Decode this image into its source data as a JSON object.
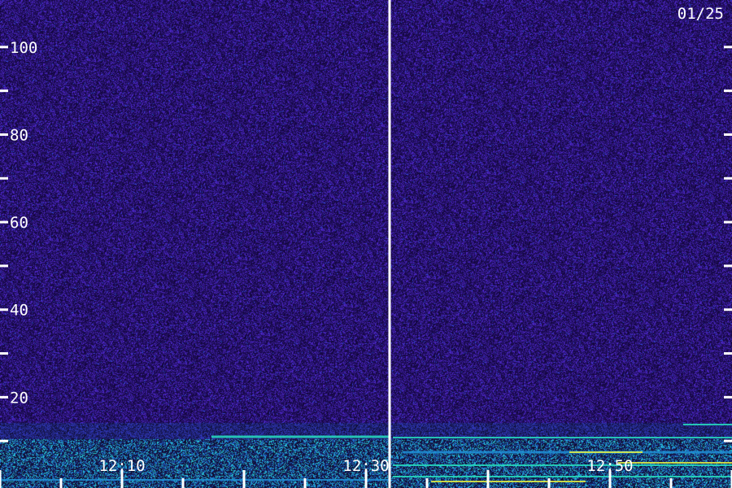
{
  "chart_data": {
    "type": "heatmap",
    "title": "",
    "xlabel": "",
    "ylabel": "",
    "date_label": "01/25",
    "ylim": [
      0,
      110
    ],
    "y_ticks_labeled": [
      20,
      40,
      60,
      80,
      100
    ],
    "y_ticks_minor": [
      10,
      30,
      50,
      70,
      90
    ],
    "x_tick_labels": [
      "12:10",
      "12:30",
      "12:50"
    ],
    "divider_time": "12:30",
    "colors": {
      "background": "#1a0a52",
      "noise_low": "#12063a",
      "noise_high": "#4a2cd8",
      "signal_low": "#1f8fd6",
      "signal_mid": "#27e0c0",
      "signal_high": "#e8f040",
      "axis": "#ffffff"
    }
  }
}
